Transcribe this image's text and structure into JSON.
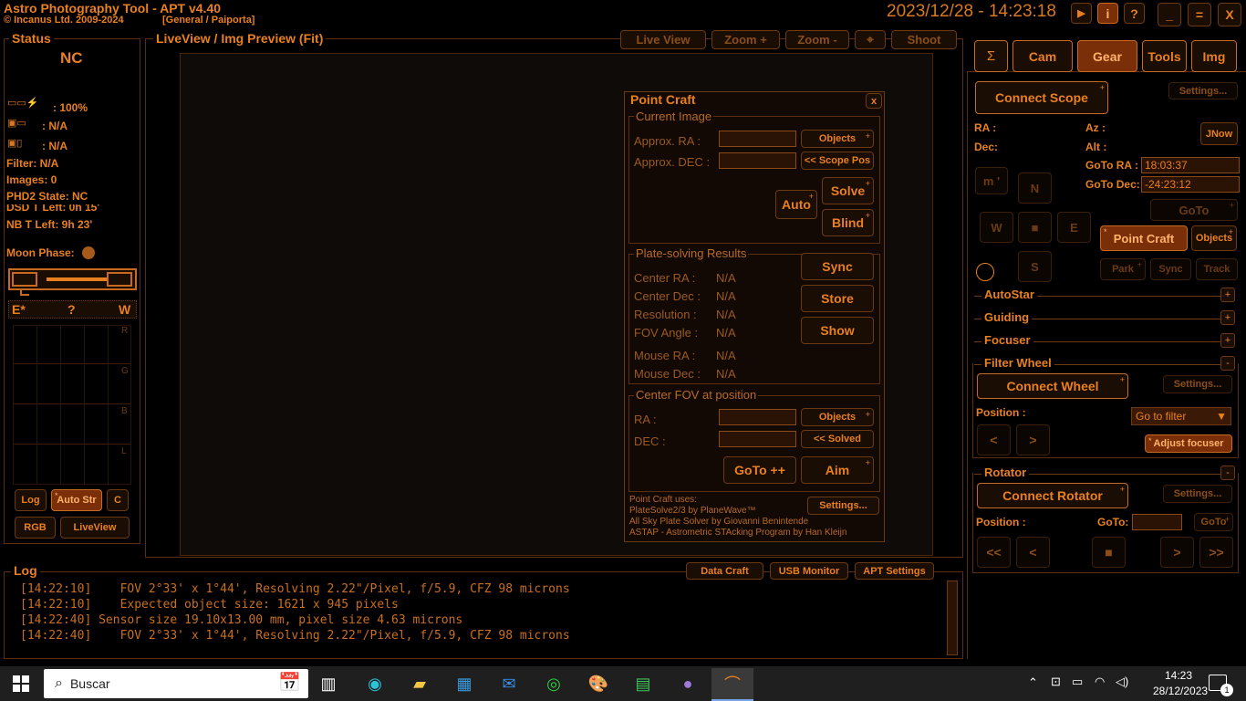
{
  "app": {
    "title": "Astro Photography Tool  -  APT v4.40",
    "copyright": "© Incanus Ltd. 2009-2024",
    "profile": "[General / Paiporta]",
    "datetime": "2023/12/28  -  14:23:18"
  },
  "window_controls": {
    "play": "▶",
    "info": "i",
    "help": "?",
    "min": "_",
    "max": "=",
    "close": "X"
  },
  "status": {
    "title": "Status",
    "state": "NC",
    "power": ": 100%",
    "cam1": ": N/A",
    "cam2": ": N/A",
    "filter": "Filter: N/A",
    "images": "Images: 0",
    "phd2": "PHD2 State: NC",
    "dsd": "DSD T Left: 0h 15'",
    "nb": "NB T Left: 9h 23'",
    "moon": "Moon Phase:",
    "ew_e": "E*",
    "ew_q": "?",
    "ew_w": "W",
    "hist": [
      "R",
      "G",
      "B",
      "L"
    ],
    "btn_log": "Log",
    "btn_autostr": "Auto Str",
    "btn_c": "C",
    "btn_rgb": "RGB",
    "btn_liveview": "LiveView"
  },
  "liveview": {
    "title": "LiveView / Img Preview (Fit)",
    "live": "Live View",
    "zoom_in": "Zoom +",
    "zoom_out": "Zoom -",
    "shoot": "Shoot"
  },
  "pointcraft": {
    "title": "Point Craft",
    "close": "x",
    "current": "Current Image",
    "approx_ra": "Approx. RA :",
    "approx_dec": "Approx. DEC :",
    "objects": "Objects",
    "scope_pos": "<< Scope Pos",
    "auto": "Auto",
    "solve": "Solve",
    "blind": "Blind",
    "results": "Plate-solving Results",
    "center_ra": "Center RA :",
    "center_dec": "Center Dec :",
    "resolution": "Resolution :",
    "fov_angle": "FOV Angle :",
    "mouse_ra": "Mouse RA :",
    "mouse_dec": "Mouse Dec :",
    "na": "N/A",
    "sync": "Sync",
    "store": "Store",
    "show": "Show",
    "center_fov": "Center FOV at position",
    "ra": "RA :",
    "dec": "DEC :",
    "objects2": "Objects",
    "solved": "<< Solved",
    "goto": "GoTo ++",
    "aim": "Aim",
    "uses": "Point Craft uses:",
    "solver1": "PlateSolve2/3 by PlaneWave™",
    "solver2": "All Sky Plate Solver by Giovanni Benintende",
    "solver3": "ASTAP - Astrometric STAcking Program by Han Kleijn",
    "settings": "Settings..."
  },
  "tabs": [
    "Σ",
    "Cam",
    "Gear",
    "Tools",
    "Img"
  ],
  "gear": {
    "connect_scope": "Connect Scope",
    "settings": "Settings...",
    "ra": "RA :",
    "dec": "Dec:",
    "az": "Az :",
    "alt": "Alt :",
    "jnow": "JNow",
    "goto_ra_lbl": "GoTo RA :",
    "goto_ra": "18:03:37",
    "goto_dec_lbl": "GoTo Dec:",
    "goto_dec": "-24:23:12",
    "m": "m '",
    "n": "N",
    "w": "W",
    "stop": "■",
    "e": "E",
    "s": "S",
    "goto": "GoTo",
    "point_craft": "Point Craft",
    "objects": "Objects",
    "park": "Park",
    "sync": "Sync",
    "track": "Track",
    "autostar": "AutoStar",
    "guiding": "Guiding",
    "focuser": "Focuser",
    "filter_wheel": "Filter Wheel",
    "connect_wheel": "Connect Wheel",
    "position": "Position :",
    "goto_filter": "Go to filter",
    "adjust_focuser": "Adjust focuser",
    "rotator": "Rotator",
    "connect_rotator": "Connect Rotator",
    "goto_lbl": "GoTo:",
    "goto_small": "GoTo",
    "prev2": "<<",
    "prev": "<",
    "next": ">",
    "next2": ">>",
    "lt": "<",
    "gt": ">"
  },
  "log": {
    "title": "Log",
    "data_craft": "Data Craft",
    "usb_monitor": "USB Monitor",
    "apt_settings": "APT Settings",
    "lines": [
      "[14:22:10]    FOV 2°33' x 1°44', Resolving 2.22\"/Pixel, f/5.9, CFZ 98 microns",
      "[14:22:10]    Expected object size: 1621 x 945 pixels",
      "[14:22:40] Sensor size 19.10x13.00 mm, pixel size 4.63 microns",
      "[14:22:40]    FOV 2°33' x 1°44', Resolving 2.22\"/Pixel, f/5.9, CFZ 98 microns"
    ]
  },
  "taskbar": {
    "search": "Buscar",
    "time": "14:23",
    "date": "28/12/2023",
    "notif": "1"
  }
}
